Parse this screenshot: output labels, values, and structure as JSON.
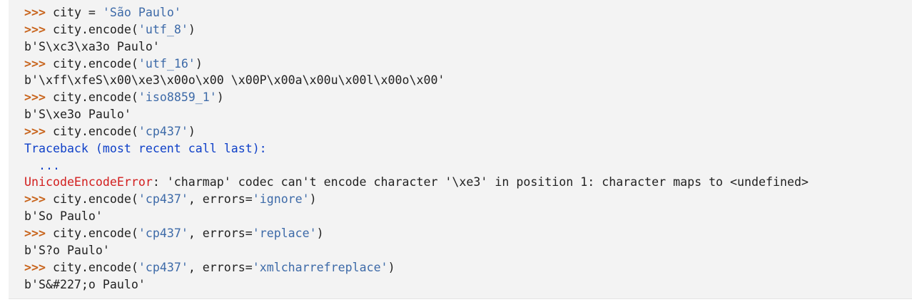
{
  "colors": {
    "background": "#f3f3f3",
    "text": "#222222",
    "prompt": "#c8641c",
    "string": "#3d6aa8",
    "traceback": "#0f40c8",
    "error": "#d21e1e"
  },
  "prompt": ">>>",
  "lines": [
    {
      "type": "input",
      "segments": [
        {
          "t": "code",
          "v": "city = "
        },
        {
          "t": "str",
          "v": "'São Paulo'"
        }
      ]
    },
    {
      "type": "input",
      "segments": [
        {
          "t": "code",
          "v": "city.encode("
        },
        {
          "t": "str",
          "v": "'utf_8'"
        },
        {
          "t": "code",
          "v": ")"
        }
      ]
    },
    {
      "type": "output",
      "text": "b'S\\xc3\\xa3o Paulo'"
    },
    {
      "type": "input",
      "segments": [
        {
          "t": "code",
          "v": "city.encode("
        },
        {
          "t": "str",
          "v": "'utf_16'"
        },
        {
          "t": "code",
          "v": ")"
        }
      ]
    },
    {
      "type": "output",
      "text": "b'\\xff\\xfeS\\x00\\xe3\\x00o\\x00 \\x00P\\x00a\\x00u\\x00l\\x00o\\x00'"
    },
    {
      "type": "input",
      "segments": [
        {
          "t": "code",
          "v": "city.encode("
        },
        {
          "t": "str",
          "v": "'iso8859_1'"
        },
        {
          "t": "code",
          "v": ")"
        }
      ]
    },
    {
      "type": "output",
      "text": "b'S\\xe3o Paulo'"
    },
    {
      "type": "input",
      "segments": [
        {
          "t": "code",
          "v": "city.encode("
        },
        {
          "t": "str",
          "v": "'cp437'"
        },
        {
          "t": "code",
          "v": ")"
        }
      ]
    },
    {
      "type": "traceback",
      "text": "Traceback (most recent call last):"
    },
    {
      "type": "ellipsis",
      "text": "  ..."
    },
    {
      "type": "error",
      "name": "UnicodeEncodeError",
      "text": ": 'charmap' codec can't encode character '\\xe3' in position 1: character maps to <undefined>"
    },
    {
      "type": "input",
      "segments": [
        {
          "t": "code",
          "v": "city.encode("
        },
        {
          "t": "str",
          "v": "'cp437'"
        },
        {
          "t": "code",
          "v": ", errors="
        },
        {
          "t": "str",
          "v": "'ignore'"
        },
        {
          "t": "code",
          "v": ")"
        }
      ]
    },
    {
      "type": "output",
      "text": "b'So Paulo'"
    },
    {
      "type": "input",
      "segments": [
        {
          "t": "code",
          "v": "city.encode("
        },
        {
          "t": "str",
          "v": "'cp437'"
        },
        {
          "t": "code",
          "v": ", errors="
        },
        {
          "t": "str",
          "v": "'replace'"
        },
        {
          "t": "code",
          "v": ")"
        }
      ]
    },
    {
      "type": "output",
      "text": "b'S?o Paulo'"
    },
    {
      "type": "input",
      "segments": [
        {
          "t": "code",
          "v": "city.encode("
        },
        {
          "t": "str",
          "v": "'cp437'"
        },
        {
          "t": "code",
          "v": ", errors="
        },
        {
          "t": "str",
          "v": "'xmlcharrefreplace'"
        },
        {
          "t": "code",
          "v": ")"
        }
      ]
    },
    {
      "type": "output",
      "text": "b'S&#227;o Paulo'"
    }
  ]
}
